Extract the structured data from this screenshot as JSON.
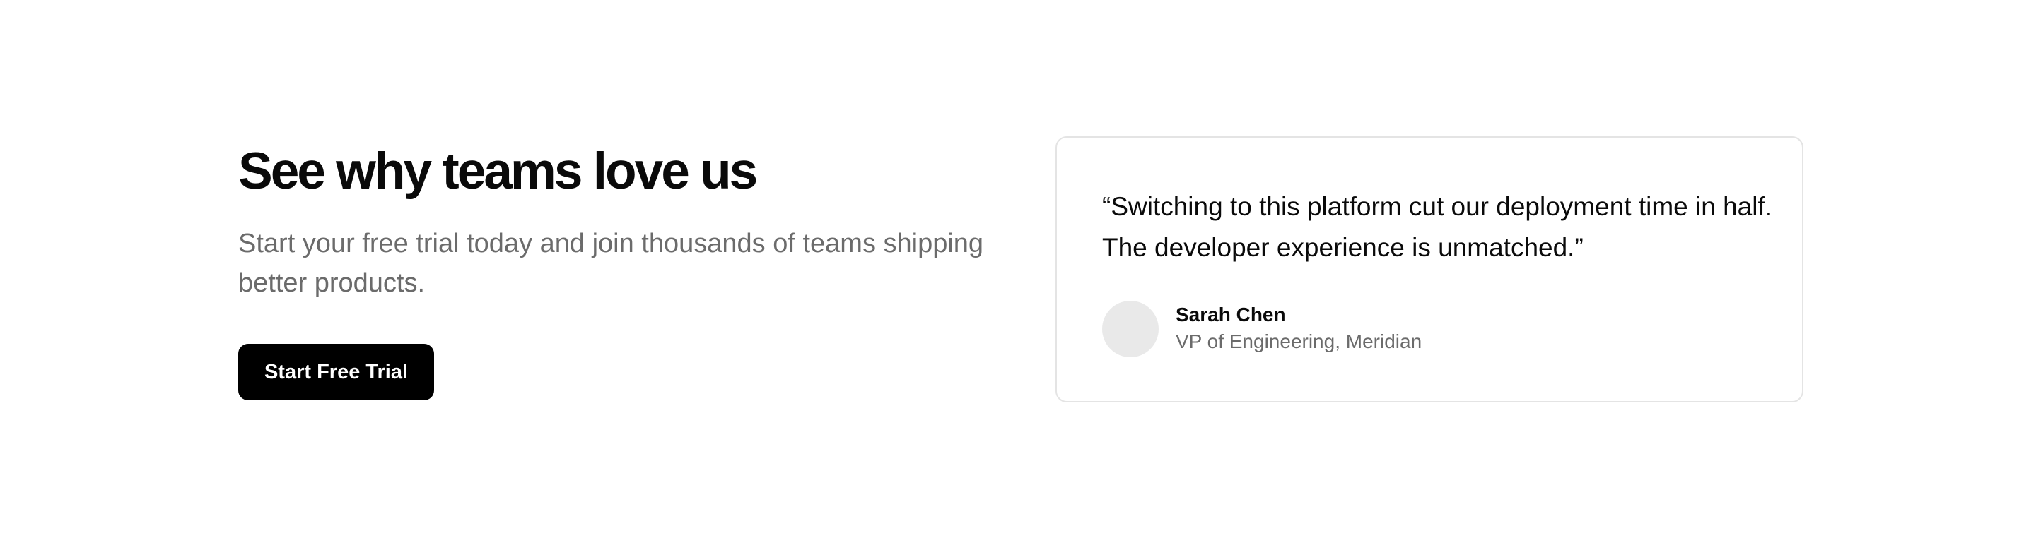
{
  "hero": {
    "headline": "See why teams love us",
    "subtitle": "Start your free trial today and join thousands of teams shipping better products.",
    "cta_label": "Start Free Trial"
  },
  "testimonial": {
    "quote": "“Switching to this platform cut our deployment time in half. The developer experience is unmatched.”",
    "author_name": "Sarah Chen",
    "author_role": "VP of Engineering, Meridian"
  },
  "colors": {
    "background": "#ffffff",
    "text_primary": "#0a0a0a",
    "text_secondary": "#6b6b6b",
    "button_background": "#000000",
    "button_text": "#ffffff",
    "card_border": "#e4e4e4",
    "avatar_placeholder": "#e9e9e9"
  }
}
